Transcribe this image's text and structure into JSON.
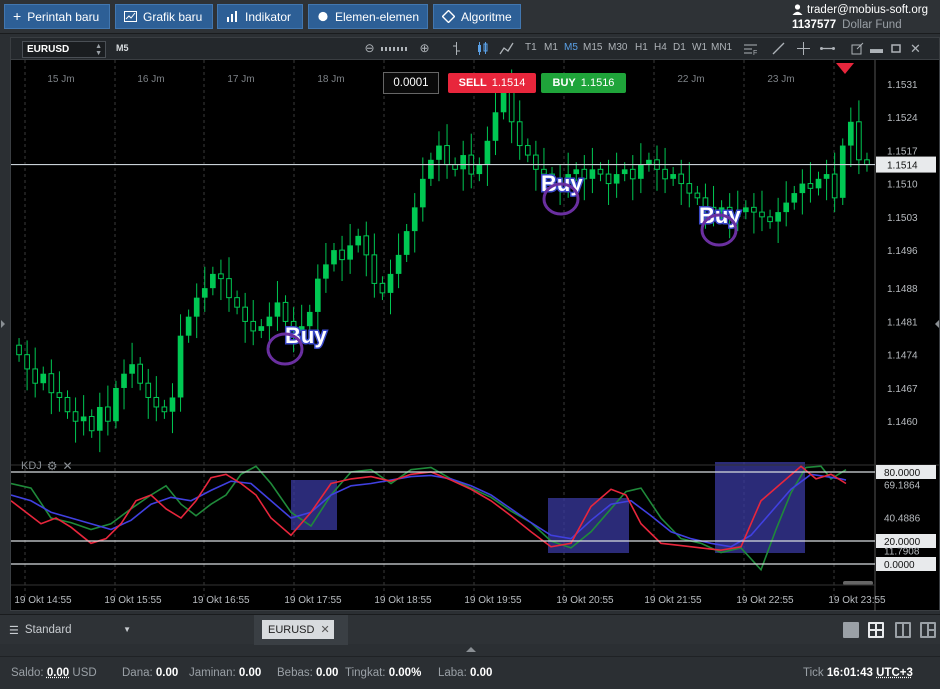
{
  "toolbar": {
    "new_position": "Perintah baru",
    "new_chart": "Grafik baru",
    "indicator": "Indikator",
    "elements": "Elemen-elemen",
    "algorithm": "Algoritme"
  },
  "account": {
    "email": "trader@mobius-soft.org",
    "number": "1137577",
    "fund": "Dollar Fund"
  },
  "chart": {
    "symbol": "EURUSD",
    "timeframe_current": "M5",
    "timeframes": [
      "T1",
      "M1",
      "M5",
      "M15",
      "M30",
      "H1",
      "H4",
      "D1",
      "W1",
      "MN1"
    ],
    "selected_timeframe": "M5",
    "order_size": "0.0001",
    "sell_label": "SELL",
    "sell_price": "1.1514",
    "buy_label": "BUY",
    "buy_price": "1.1516",
    "current_price": "1.1514",
    "price_ticks": [
      "1.1531",
      "1.1524",
      "1.1517",
      "1.1510",
      "1.1503",
      "1.1496",
      "1.1488",
      "1.1481",
      "1.1474",
      "1.1467",
      "1.1460"
    ],
    "date_labels": [
      "15 Jm",
      "16 Jm",
      "17 Jm",
      "18 Jm",
      "19 Jm",
      "20 Jm",
      "21 Jm",
      "22 Jm",
      "23 Jm"
    ],
    "annotations": [
      "Buy",
      "Buy",
      "Buy"
    ],
    "indicator_name": "KDJ",
    "kdj_levels": [
      "80.0000",
      "69.1864",
      "40.4886",
      "20.0000",
      "11.7908",
      "0.0000"
    ],
    "time_labels": [
      "19 Okt 14:55",
      "19 Okt 15:55",
      "19 Okt 16:55",
      "19 Okt 17:55",
      "19 Okt 18:55",
      "19 Okt 19:55",
      "19 Okt 20:55",
      "19 Okt 21:55",
      "19 Okt 22:55",
      "19 Okt 23:55"
    ],
    "colors": {
      "bull": "#00c853",
      "bear": "#00c853",
      "k": "#e8263c",
      "d": "#4040e0",
      "j": "#1f8a3a",
      "signal": "#3a3aa0"
    }
  },
  "tabs": {
    "template": "Standard",
    "active_tab": "EURUSD"
  },
  "status": {
    "saldo_label": "Saldo:",
    "saldo_value": "0.00",
    "saldo_ccy": "USD",
    "dana_label": "Dana:",
    "dana_value": "0.00",
    "jaminan_label": "Jaminan:",
    "jaminan_value": "0.00",
    "bebas_label": "Bebas:",
    "bebas_value": "0.00",
    "tingkat_label": "Tingkat:",
    "tingkat_value": "0.00%",
    "laba_label": "Laba:",
    "laba_value": "0.00",
    "tick_label": "Tick",
    "time": "16:01:43",
    "tz": "UTC+3"
  }
}
